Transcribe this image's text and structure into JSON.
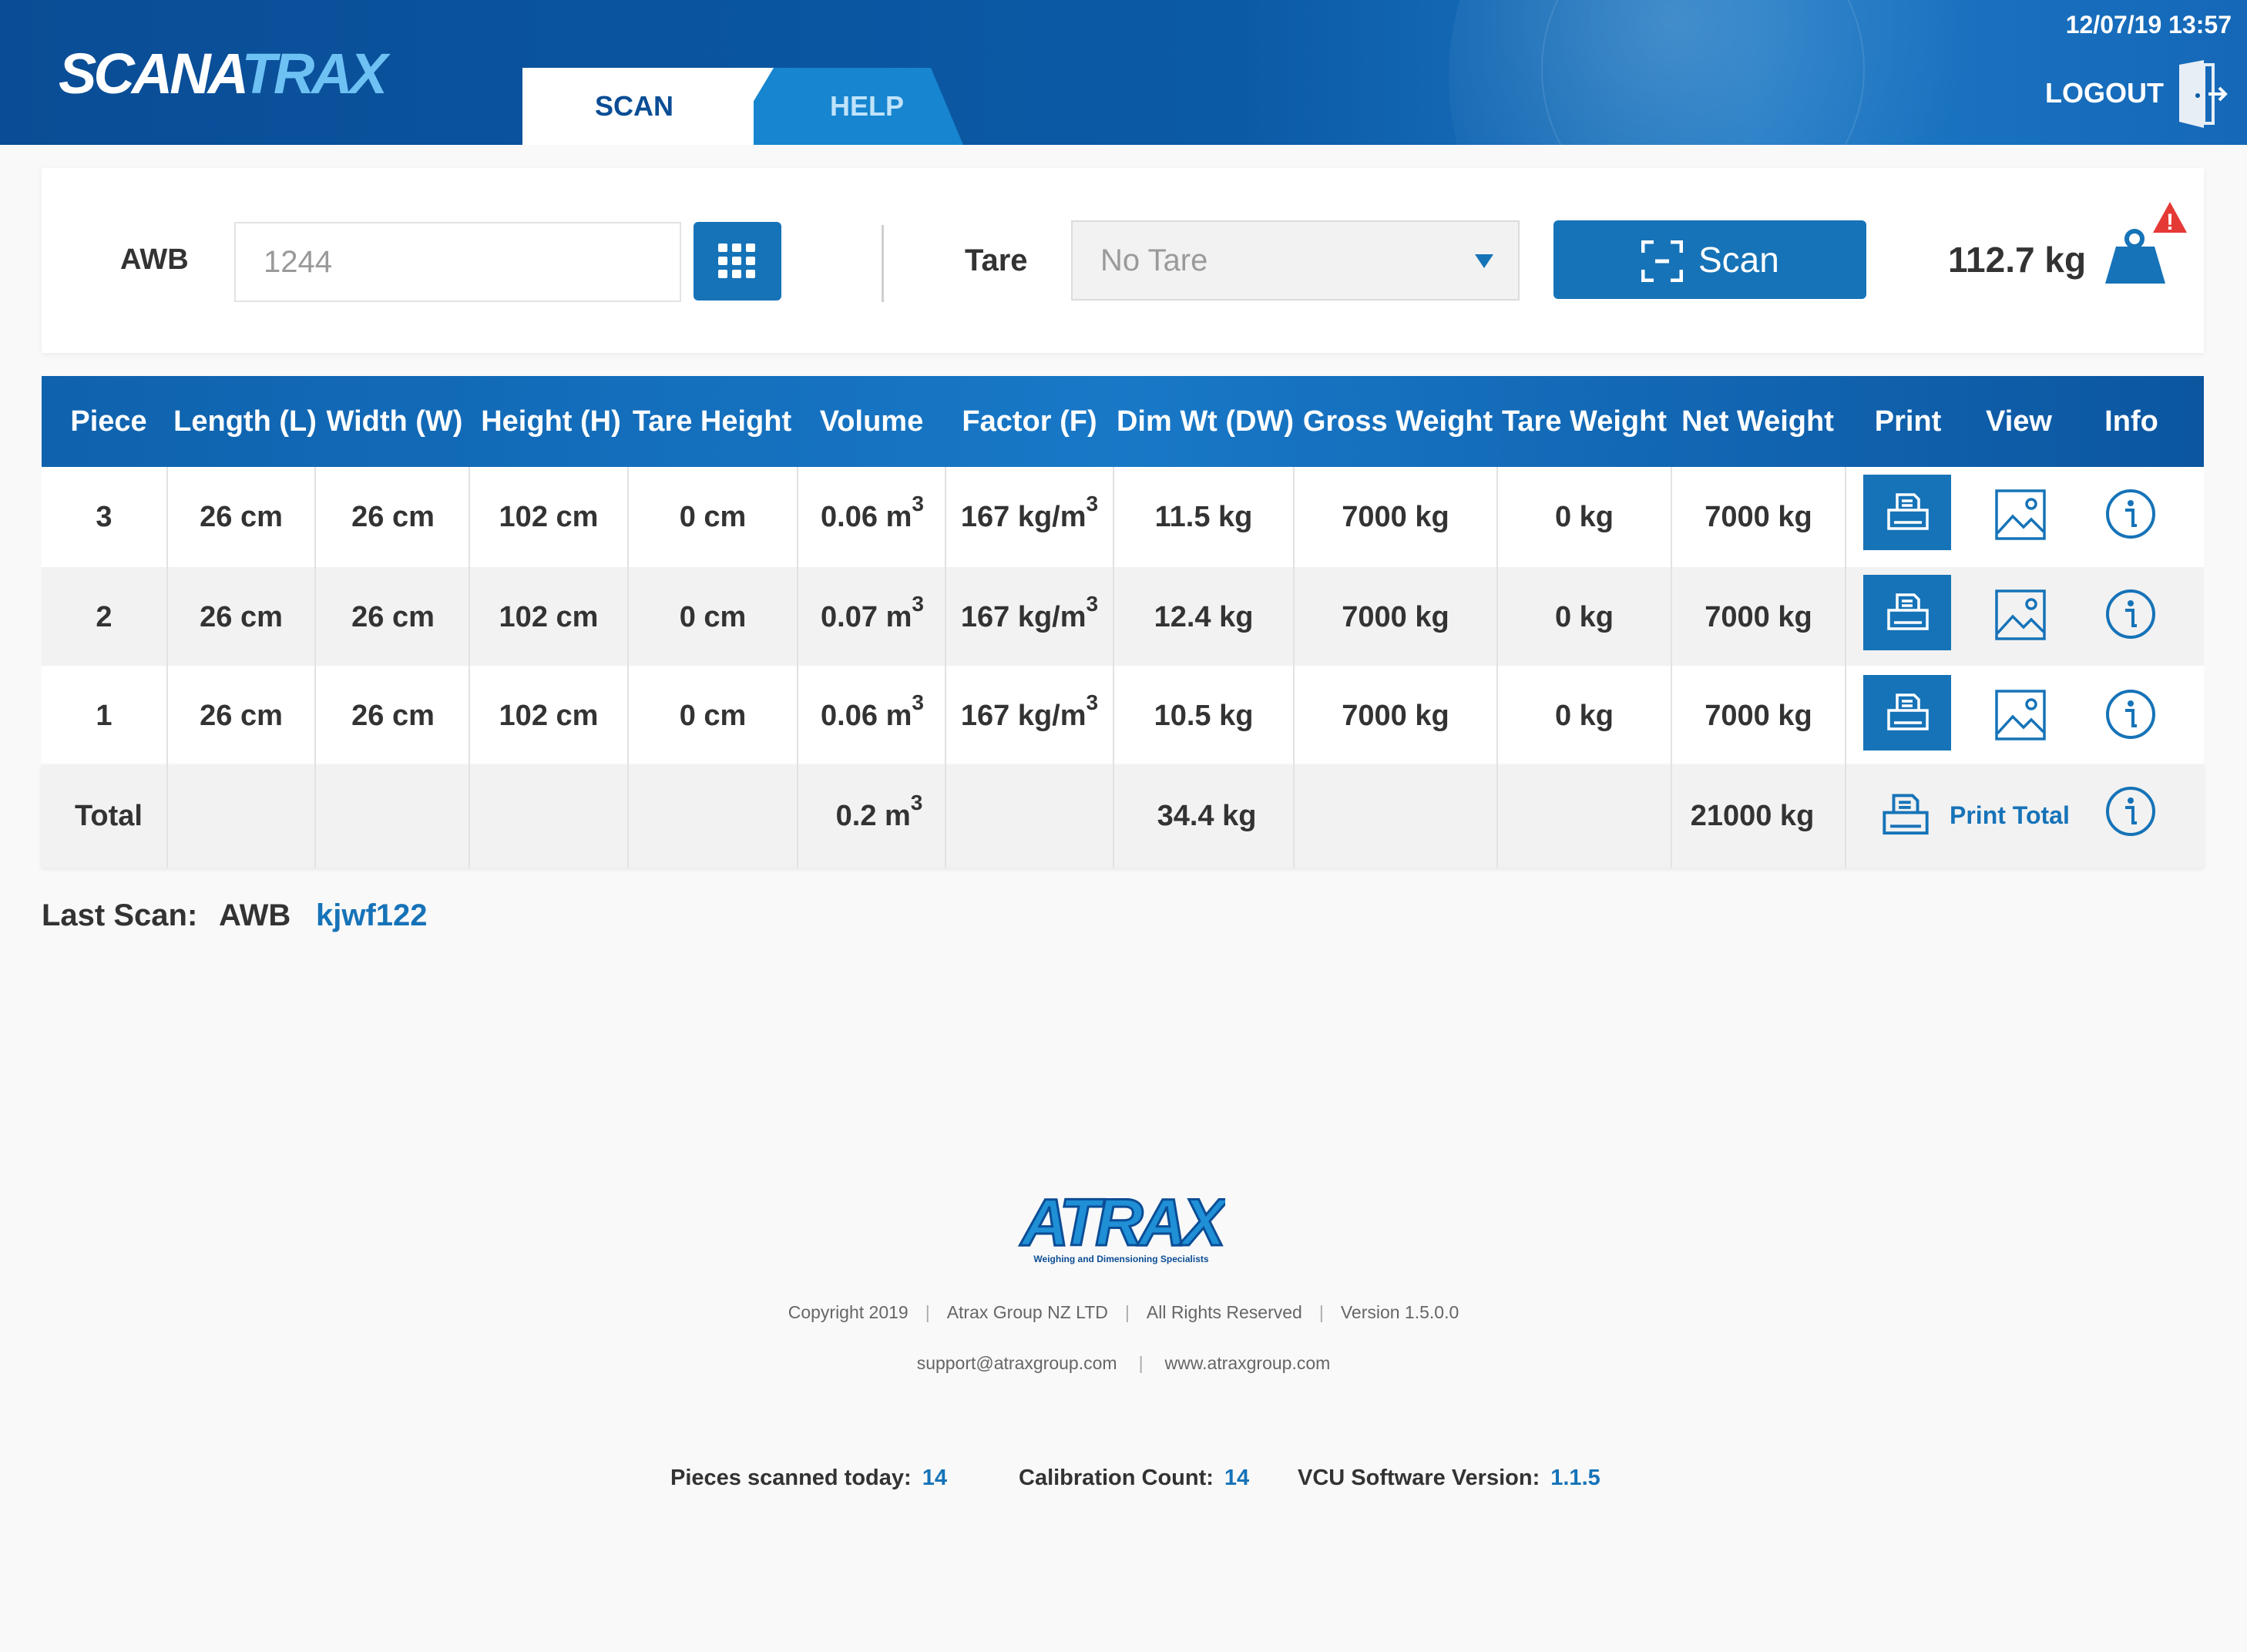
{
  "header": {
    "logo_part1": "SCANA",
    "logo_part2": "TRAX",
    "tabs": [
      {
        "label": "SCAN",
        "active": true
      },
      {
        "label": "HELP",
        "active": false
      }
    ],
    "datetime": "12/07/19 13:57",
    "logout_label": "LOGOUT"
  },
  "scan_bar": {
    "awb_label": "AWB",
    "awb_value": "1244",
    "tare_label": "Tare",
    "tare_selected": "No Tare",
    "scan_button_label": "Scan",
    "weight": "112.7 kg",
    "weight_alert": "!"
  },
  "table": {
    "headers": [
      "Piece",
      "Length (L)",
      "Width (W)",
      "Height (H)",
      "Tare Height",
      "Volume",
      "Factor (F)",
      "Dim Wt (DW)",
      "Gross Weight",
      "Tare Weight",
      "Net Weight",
      "Print",
      "View",
      "Info"
    ],
    "rows": [
      {
        "piece": "3",
        "length": "26 cm",
        "width": "26 cm",
        "height": "102 cm",
        "tare_height": "0 cm",
        "volume": "0.06 m",
        "volume_exp": "3",
        "factor": "167 kg/m",
        "factor_exp": "3",
        "dim_wt": "11.5 kg",
        "gross": "7000 kg",
        "tare_wt": "0 kg",
        "net": "7000 kg"
      },
      {
        "piece": "2",
        "length": "26 cm",
        "width": "26 cm",
        "height": "102 cm",
        "tare_height": "0 cm",
        "volume": "0.07 m",
        "volume_exp": "3",
        "factor": "167 kg/m",
        "factor_exp": "3",
        "dim_wt": "12.4 kg",
        "gross": "7000 kg",
        "tare_wt": "0 kg",
        "net": "7000 kg"
      },
      {
        "piece": "1",
        "length": "26 cm",
        "width": "26 cm",
        "height": "102 cm",
        "tare_height": "0 cm",
        "volume": "0.06 m",
        "volume_exp": "3",
        "factor": "167 kg/m",
        "factor_exp": "3",
        "dim_wt": "10.5 kg",
        "gross": "7000 kg",
        "tare_wt": "0 kg",
        "net": "7000 kg"
      }
    ],
    "total": {
      "label": "Total",
      "volume": "0.2 m",
      "volume_exp": "3",
      "dim_wt": "34.4 kg",
      "net": "21000 kg",
      "print_total_label": "Print Total"
    }
  },
  "last_scan": {
    "label": "Last Scan:",
    "type": "AWB",
    "value": "kjwf122"
  },
  "footer": {
    "brand": "ATRAX",
    "brand_tagline": "Weighing and Dimensioning Specialists",
    "copyright": "Copyright 2019",
    "company": "Atrax Group NZ LTD",
    "rights": "All Rights Reserved",
    "version": "Version 1.5.0.0",
    "email": "support@atraxgroup.com",
    "website": "www.atraxgroup.com",
    "stats": [
      {
        "label": "Pieces scanned today:",
        "value": "14"
      },
      {
        "label": "Calibration Count:",
        "value": "14"
      },
      {
        "label": "VCU Software Version:",
        "value": "1.1.5"
      }
    ]
  },
  "colors": {
    "primary": "#1673b8",
    "header_dark": "#0a4d96",
    "alert": "#e53935",
    "logo_accent": "#6ec1f3"
  },
  "icons": [
    "logout-door-icon",
    "keypad-grid-icon",
    "scan-frame-icon",
    "weight-icon",
    "alert-icon",
    "print-icon",
    "image-icon",
    "info-icon"
  ]
}
